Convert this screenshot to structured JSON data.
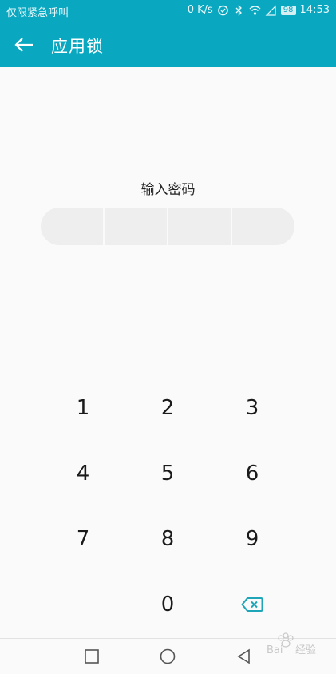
{
  "status_bar": {
    "carrier_text": "仅限紧急呼叫",
    "network_speed": "0 K/s",
    "battery_level": "98",
    "time": "14:53",
    "icons": [
      "data-saver-icon",
      "bluetooth-icon",
      "wifi-icon",
      "signal-icon",
      "battery-icon"
    ]
  },
  "toolbar": {
    "title": "应用锁",
    "back_icon": "arrow-left-icon"
  },
  "prompt": "输入密码",
  "pin": {
    "slots": 4,
    "entered": 0
  },
  "keypad": {
    "keys": [
      "1",
      "2",
      "3",
      "4",
      "5",
      "6",
      "7",
      "8",
      "9",
      "",
      "0",
      "backspace"
    ]
  },
  "nav_bar": {
    "icons": [
      "recent-apps-icon",
      "home-icon",
      "back-triangle-icon"
    ]
  },
  "colors": {
    "primary": "#0aa8c0",
    "background": "#fafafa",
    "pin_box": "#eeeeee",
    "backspace": "#1ea5b8"
  },
  "watermark": {
    "text": "Bai经验"
  }
}
